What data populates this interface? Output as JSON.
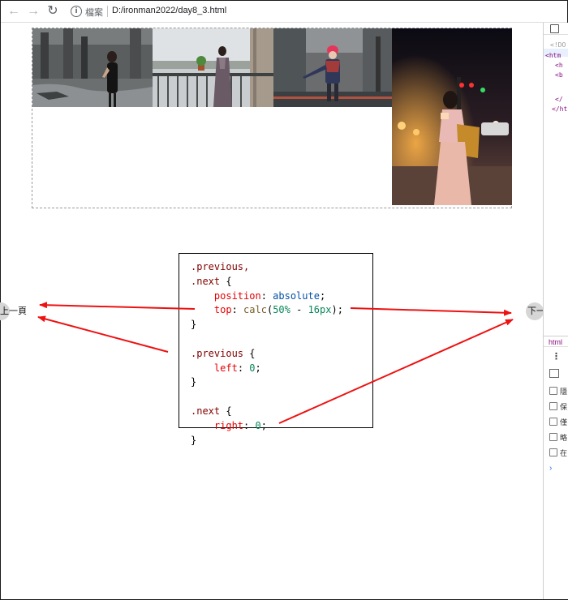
{
  "browser": {
    "origin_label": "檔案",
    "url": "D:/ironman2022/day8_3.html"
  },
  "page": {
    "prev_button": "上一頁",
    "next_button": "下一頁"
  },
  "code": {
    "lines": [
      [
        [
          ".previous,",
          "sel"
        ]
      ],
      [
        [
          ".next",
          "sel"
        ],
        [
          " {",
          "pun"
        ]
      ],
      [
        [
          "    ",
          "pun"
        ],
        [
          "position",
          "prop"
        ],
        [
          ": ",
          "pun"
        ],
        [
          "absolute",
          "kw"
        ],
        [
          ";",
          "pun"
        ]
      ],
      [
        [
          "    ",
          "pun"
        ],
        [
          "top",
          "prop"
        ],
        [
          ": ",
          "pun"
        ],
        [
          "calc",
          "fn"
        ],
        [
          "(",
          "pun"
        ],
        [
          "50%",
          "num"
        ],
        [
          " - ",
          "pun"
        ],
        [
          "16px",
          "num"
        ],
        [
          ");",
          "pun"
        ]
      ],
      [
        [
          "}",
          "pun"
        ]
      ],
      [
        [
          "",
          "pun"
        ]
      ],
      [
        [
          ".previous",
          "sel"
        ],
        [
          " {",
          "pun"
        ]
      ],
      [
        [
          "    ",
          "pun"
        ],
        [
          "left",
          "prop"
        ],
        [
          ": ",
          "pun"
        ],
        [
          "0",
          "num"
        ],
        [
          ";",
          "pun"
        ]
      ],
      [
        [
          "}",
          "pun"
        ]
      ],
      [
        [
          "",
          "pun"
        ]
      ],
      [
        [
          ".next",
          "sel"
        ],
        [
          " {",
          "pun"
        ]
      ],
      [
        [
          "    ",
          "pun"
        ],
        [
          "right",
          "prop"
        ],
        [
          ": ",
          "pun"
        ],
        [
          "0",
          "num"
        ],
        [
          ";",
          "pun"
        ]
      ],
      [
        [
          "}",
          "pun"
        ]
      ]
    ]
  },
  "devtools": {
    "tree": [
      "<!DO",
      "<htm",
      "<h",
      "<b",
      "</",
      "</ht"
    ],
    "breadcrumb": "html",
    "checkbox_labels": [
      "隱",
      "保",
      "僅",
      "略",
      "在"
    ]
  },
  "colors": {
    "arrow": "#ee1111",
    "code_selector": "#800000",
    "code_property": "#e50000",
    "code_keyword": "#0451a5",
    "code_function": "#795e26",
    "code_number": "#098658"
  }
}
